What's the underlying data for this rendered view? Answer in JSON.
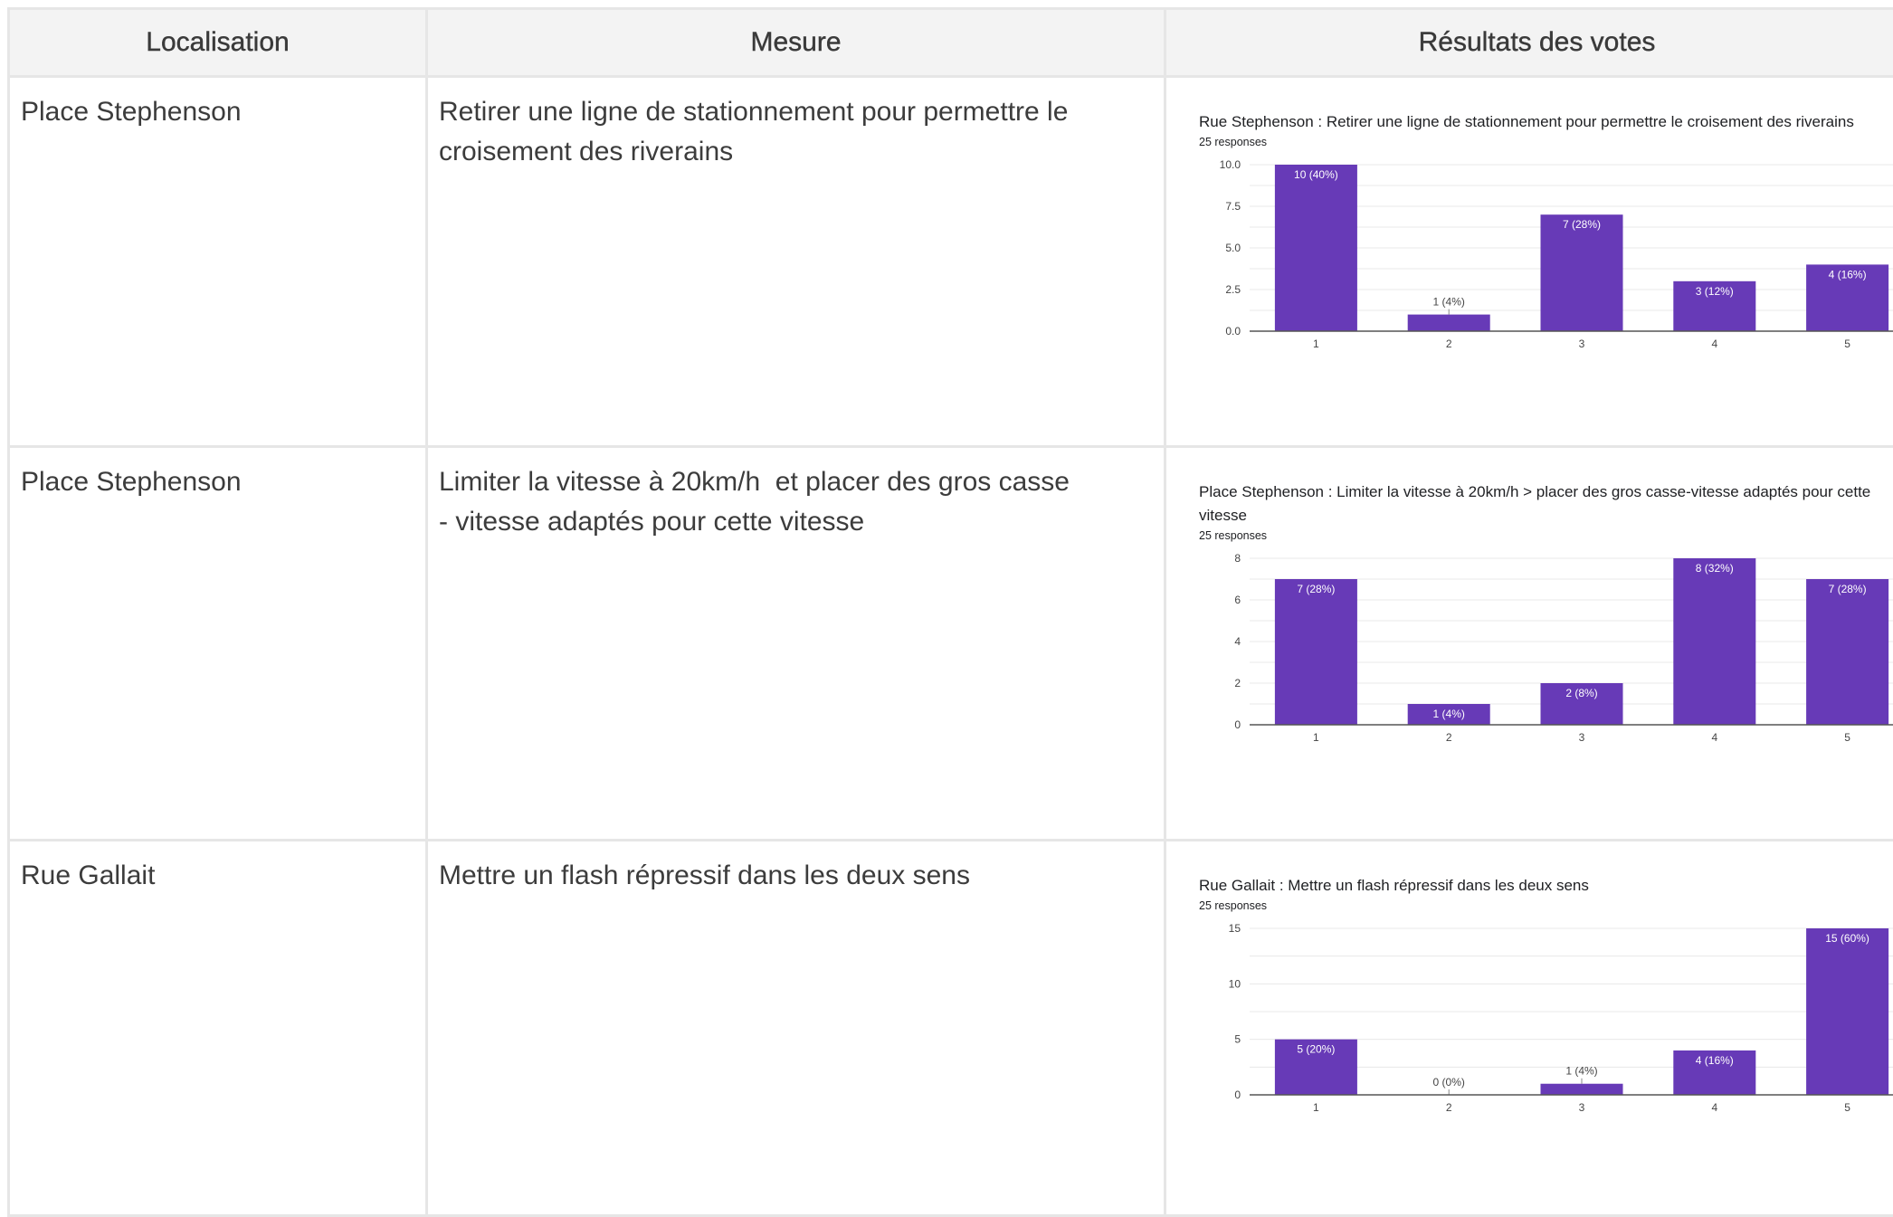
{
  "table": {
    "headers": [
      "Localisation",
      "Mesure",
      "Résultats des votes"
    ],
    "rows": [
      {
        "localisation": "Place Stephenson",
        "mesure": "Retirer une ligne de stationnement pour permettre le croisement des riverains"
      },
      {
        "localisation": "Place Stephenson",
        "mesure": "Limiter la vitesse à 20km/h  et placer des gros casse            - vitesse adaptés pour cette vitesse"
      },
      {
        "localisation": "Rue Gallait",
        "mesure": "Mettre un flash répressif dans les deux sens"
      }
    ]
  },
  "colors": {
    "bar": "#673ab7",
    "grid": "#e8e8e8",
    "axis": "#555555",
    "header_bg": "#f3f3f3",
    "border": "#e6e6e6"
  },
  "chart_data": [
    {
      "type": "bar",
      "title": "Rue Stephenson : Retirer une ligne de stationnement pour permettre le croisement des riverains",
      "subtitle": "25 responses",
      "categories": [
        "1",
        "2",
        "3",
        "4",
        "5"
      ],
      "values": [
        10,
        1,
        7,
        3,
        4
      ],
      "labels": [
        "10 (40%)",
        "1 (4%)",
        "7 (28%)",
        "3 (12%)",
        "4 (16%)"
      ],
      "yticks": [
        "0.0",
        "2.5",
        "5.0",
        "7.5",
        "10.0"
      ],
      "ylim": [
        0,
        10
      ],
      "grid": true
    },
    {
      "type": "bar",
      "title": "Place Stephenson : Limiter la vitesse à 20km/h  > placer des gros casse-vitesse adaptés pour cette vitesse",
      "subtitle": "25 responses",
      "categories": [
        "1",
        "2",
        "3",
        "4",
        "5"
      ],
      "values": [
        7,
        1,
        2,
        8,
        7
      ],
      "labels": [
        "7 (28%)",
        "1 (4%)",
        "2 (8%)",
        "8 (32%)",
        "7 (28%)"
      ],
      "yticks": [
        "0",
        "2",
        "4",
        "6",
        "8"
      ],
      "ylim": [
        0,
        8
      ],
      "grid": true
    },
    {
      "type": "bar",
      "title": "Rue Gallait : Mettre un flash répressif dans les deux sens",
      "subtitle": "25 responses",
      "categories": [
        "1",
        "2",
        "3",
        "4",
        "5"
      ],
      "values": [
        5,
        0,
        1,
        4,
        15
      ],
      "labels": [
        "5 (20%)",
        "0 (0%)",
        "1 (4%)",
        "4 (16%)",
        "15 (60%)"
      ],
      "yticks": [
        "0",
        "5",
        "10",
        "15"
      ],
      "ylim": [
        0,
        15
      ],
      "grid": true
    }
  ]
}
